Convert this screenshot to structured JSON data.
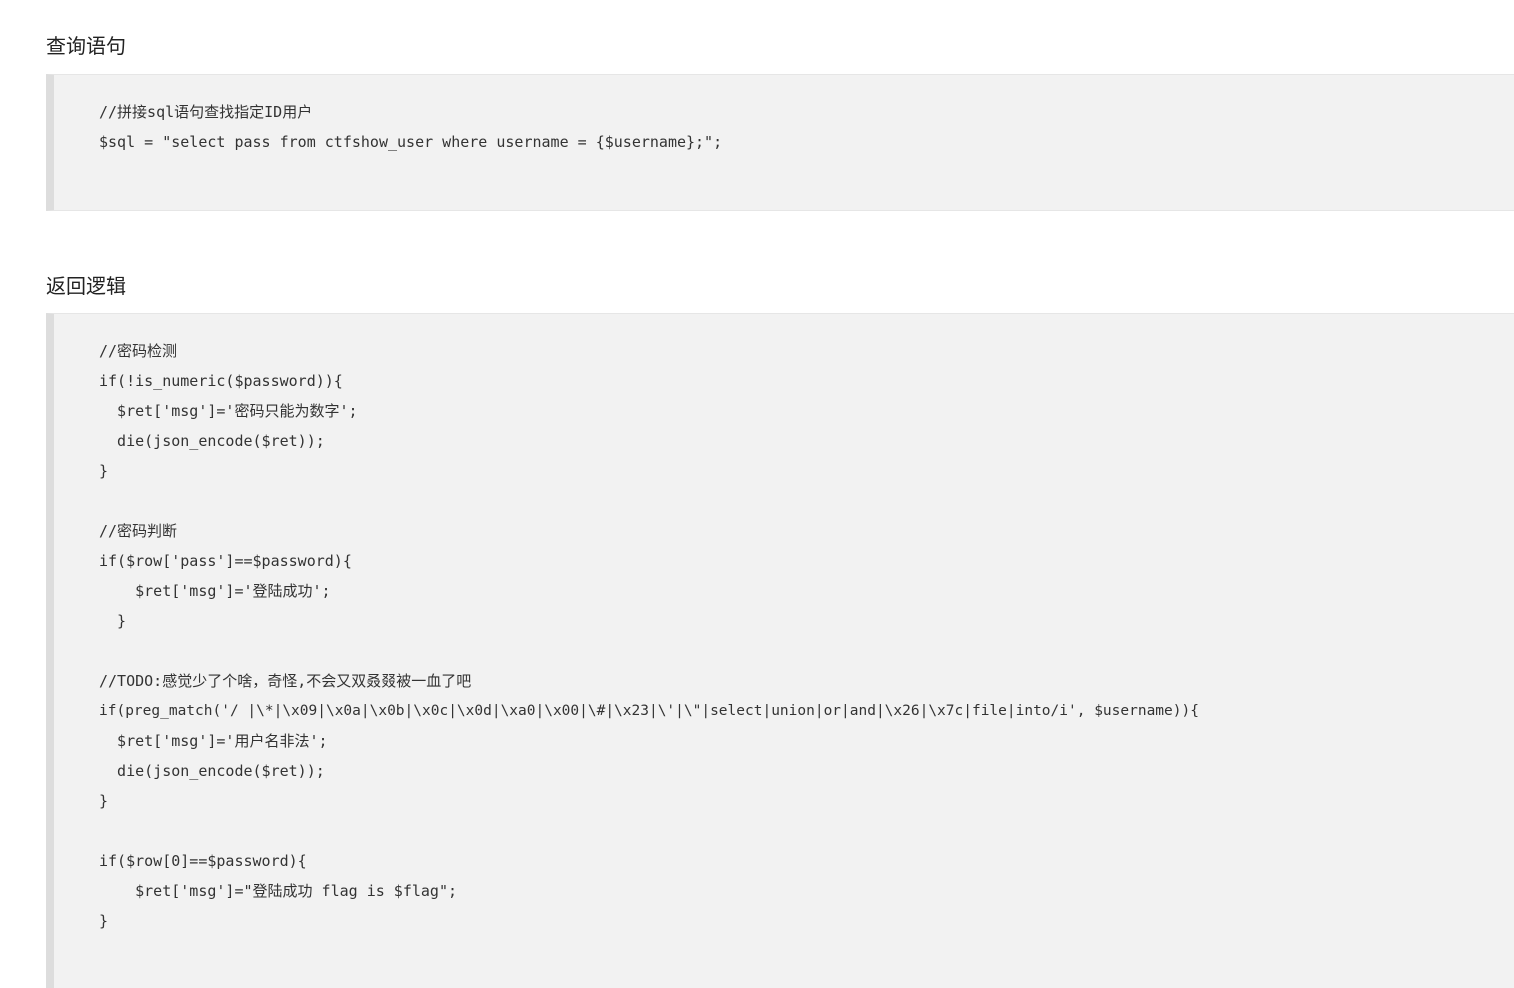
{
  "query_section": {
    "title": "查询语句",
    "lines": [
      "//拼接sql语句查找指定ID用户",
      "$sql = \"select pass from ctfshow_user where username = {$username};\";"
    ]
  },
  "logic_section": {
    "title": "返回逻辑",
    "lines": [
      "//密码检测",
      "if(!is_numeric($password)){",
      "  $ret['msg']='密码只能为数字';",
      "  die(json_encode($ret));",
      "}",
      "",
      "//密码判断",
      "if($row['pass']==$password){",
      "    $ret['msg']='登陆成功';",
      "  }",
      "",
      "//TODO:感觉少了个啥，奇怪,不会又双叒叕被一血了吧",
      "if(preg_match('/ |\\*|\\x09|\\x0a|\\x0b|\\x0c|\\x0d|\\xa0|\\x00|\\#|\\x23|\\'|\\\"|select|union|or|and|\\x26|\\x7c|file|into/i', $username)){",
      "  $ret['msg']='用户名非法';",
      "  die(json_encode($ret));",
      "}",
      "",
      "if($row[0]==$password){",
      "    $ret['msg']=\"登陆成功 flag is $flag\";",
      "}"
    ]
  }
}
